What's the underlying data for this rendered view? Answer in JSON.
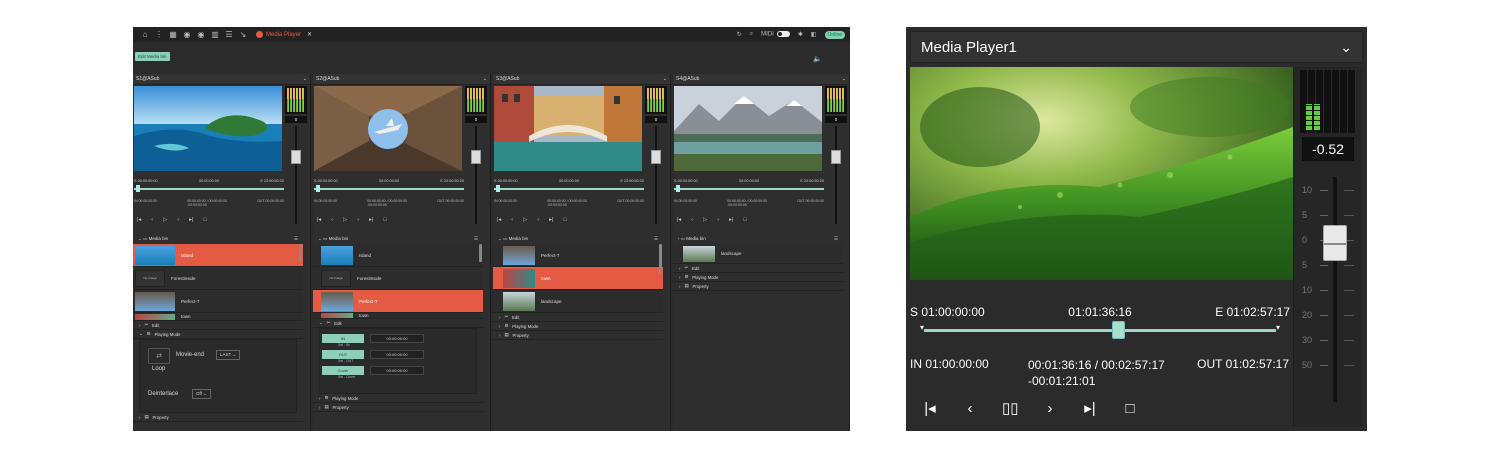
{
  "left_app": {
    "tab_label": "Media Player",
    "midi_label": "MIDI",
    "online_label": "Online",
    "edit_bin_button": "Edit Media bin",
    "columns": [
      {
        "source": "S1@ASub",
        "meter_value": "0",
        "tc_s": "S 00:00:00:00",
        "tc_cur": "00:00:00:00",
        "tc_e": "E 23:50:50:20",
        "in": "IN 00:00:00:00",
        "pos": "00:00:00:00 / 00:00:00:00",
        "rem": "-00:00:00:00",
        "out": "OUT 00:00:00:00",
        "bin_label": "Media bin",
        "items": [
          "Island",
          "Forestinside",
          "Perfect-T",
          "town"
        ],
        "no_image": "No Image",
        "edit_label": "Edit",
        "playing_mode_label": "Playing Mode",
        "movie_end_label": "Movie-end",
        "movie_end_value": "LAST",
        "loop_label": "Loop",
        "deinterlace_label": "Deinterlace",
        "deinterlace_value": "Off",
        "property_label": "Property"
      },
      {
        "source": "S2@ASub",
        "meter_value": "0",
        "tc_s": "S 00:00:00:00",
        "tc_cur": "00:00:00:00",
        "tc_e": "E 23:50:50:20",
        "in": "IN 00:00:00:00",
        "pos": "00:00:00:00 / 00:00:00:00",
        "rem": "-00:00:00:00",
        "out": "OUT 00:00:00:00",
        "bin_label": "Media bin",
        "items": [
          "Island",
          "Forestinside",
          "Perfect-T",
          "town"
        ],
        "no_image": "No Image",
        "edit_label": "Edit",
        "in_btn": "IN",
        "in_sub": "Set - IN",
        "in_tc": "00:00:00:00",
        "out_btn": "OUT",
        "out_sub": "Set - OUT",
        "out_tc": "00:00:00:00",
        "cover_btn": "Cover",
        "cover_sub": "Set - Cover",
        "cover_tc": "00:00:00:00",
        "playing_mode_label": "Playing Mode",
        "property_label": "Property"
      },
      {
        "source": "S3@ASub",
        "meter_value": "0",
        "tc_s": "S 00:00:00:00",
        "tc_cur": "00:00:00:00",
        "tc_e": "E 23:50:50:20",
        "in": "IN 00:00:00:00",
        "pos": "00:00:00:00 / 00:00:00:00",
        "rem": "-00:00:00:00",
        "out": "OUT 00:00:00:00",
        "bin_label": "Media bin",
        "items": [
          "Perfect-T",
          "town",
          "landscape"
        ],
        "edit_label": "Edit",
        "playing_mode_label": "Playing Mode",
        "property_label": "Property"
      },
      {
        "source": "S4@ASub",
        "meter_value": "0",
        "tc_s": "S 00:00:00:00",
        "tc_cur": "00:00:00:00",
        "tc_e": "E 23:50:50:20",
        "in": "IN 00:00:00:00",
        "pos": "00:00:00:00 / 00:00:00:00",
        "rem": "-00:00:00:00",
        "out": "OUT 00:00:00:00",
        "bin_label": "Media bin",
        "items": [
          "landscape"
        ],
        "edit_label": "Edit",
        "playing_mode_label": "Playing Mode",
        "property_label": "Property"
      }
    ]
  },
  "media_player": {
    "title": "Media Player1",
    "meter_value": "-0.52",
    "tc_start": "S 01:00:00:00",
    "tc_current": "01:01:36:16",
    "tc_end": "E 01:02:57:17",
    "in": "IN 01:00:00:00",
    "position": "00:01:36:16 / 00:02:57:17",
    "remaining": "-00:01:21:01",
    "out": "OUT 01:02:57:17",
    "scale": [
      "10",
      "5",
      "0",
      "5",
      "10",
      "20",
      "30",
      "50"
    ],
    "playhead_fraction": 0.55
  },
  "colors": {
    "accent": "#8ecfbb",
    "selected": "#e55a43",
    "bg": "#2b2b2b"
  }
}
